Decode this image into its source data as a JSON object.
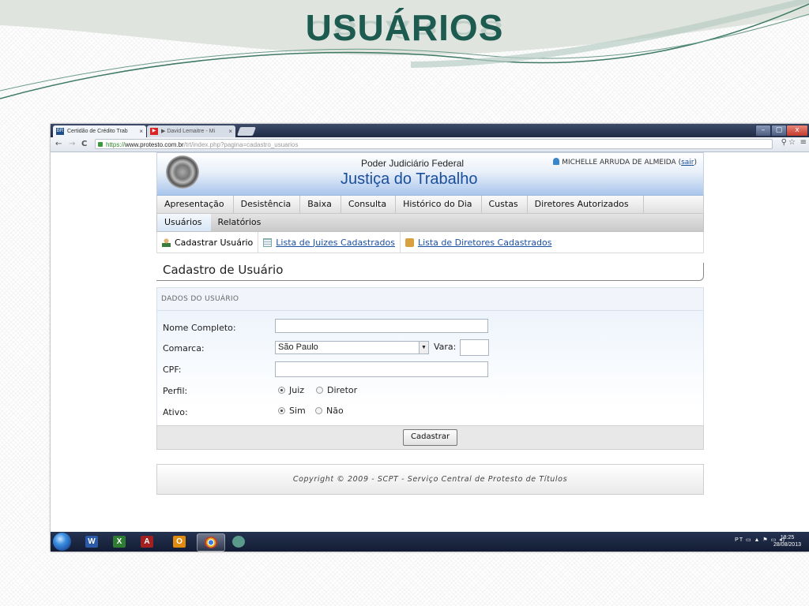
{
  "slide": {
    "title": "USUÁRIOS"
  },
  "browser": {
    "tabs": [
      {
        "label": "Certidão de Crédito Trab",
        "close": "×"
      },
      {
        "label": "▶ David Lemaitre - Mi",
        "close": "×"
      }
    ],
    "window_controls": {
      "minimize": "–",
      "maximize": "▢",
      "close": "x"
    },
    "nav": {
      "back": "←",
      "forward": "→",
      "reload": "C"
    },
    "url": {
      "scheme": "https://",
      "domain": "www.protesto.com.br",
      "path": "/trt/index.php?pagina=cadastro_usuarios"
    },
    "toolbar_icons": {
      "zoom": "⚲",
      "star": "☆",
      "menu": "≡"
    }
  },
  "page": {
    "header": {
      "org": "Poder Judiciário Federal",
      "name": "Justiça do Trabalho",
      "user": "MICHELLE ARRUDA DE ALMEIDA",
      "logout_open": "(",
      "logout": "sair",
      "logout_close": ")"
    },
    "menu_primary": [
      "Apresentação",
      "Desistência",
      "Baixa",
      "Consulta",
      "Histórico do Dia",
      "Custas",
      "Diretores Autorizados"
    ],
    "menu_secondary": [
      "Usuários",
      "Relatórios"
    ],
    "submenu": [
      "Cadastrar Usuário",
      "Lista de Juizes Cadastrados",
      "Lista de Diretores Cadastrados"
    ],
    "form": {
      "title": "Cadastro de Usuário",
      "section": "DADOS DO USUÁRIO",
      "labels": {
        "nome": "Nome Completo:",
        "comarca": "Comarca:",
        "cpf": "CPF:",
        "perfil": "Perfil:",
        "ativo": "Ativo:",
        "vara": "Vara:"
      },
      "values": {
        "nome": "",
        "comarca": "São Paulo",
        "vara": "",
        "cpf": ""
      },
      "perfil_options": [
        "Juiz",
        "Diretor"
      ],
      "perfil_selected": "Juiz",
      "ativo_options": [
        "Sim",
        "Não"
      ],
      "ativo_selected": "Sim",
      "submit": "Cadastrar"
    },
    "footer": "Copyright © 2009 - SCPT - Serviço Central de Protesto de Títulos"
  },
  "taskbar": {
    "apps": [
      {
        "name": "word",
        "letter": "W",
        "color": "#2b5aa8"
      },
      {
        "name": "excel",
        "letter": "X",
        "color": "#2e7d32"
      },
      {
        "name": "access",
        "letter": "A",
        "color": "#a32020"
      },
      {
        "name": "outlook",
        "letter": "O",
        "color": "#e08a10"
      },
      {
        "name": "chrome",
        "letter": "",
        "color": "#d8b020"
      },
      {
        "name": "people",
        "letter": "",
        "color": "#5a9a8a"
      }
    ],
    "tray": "PT",
    "time": "18:25",
    "date": "28/08/2013"
  }
}
